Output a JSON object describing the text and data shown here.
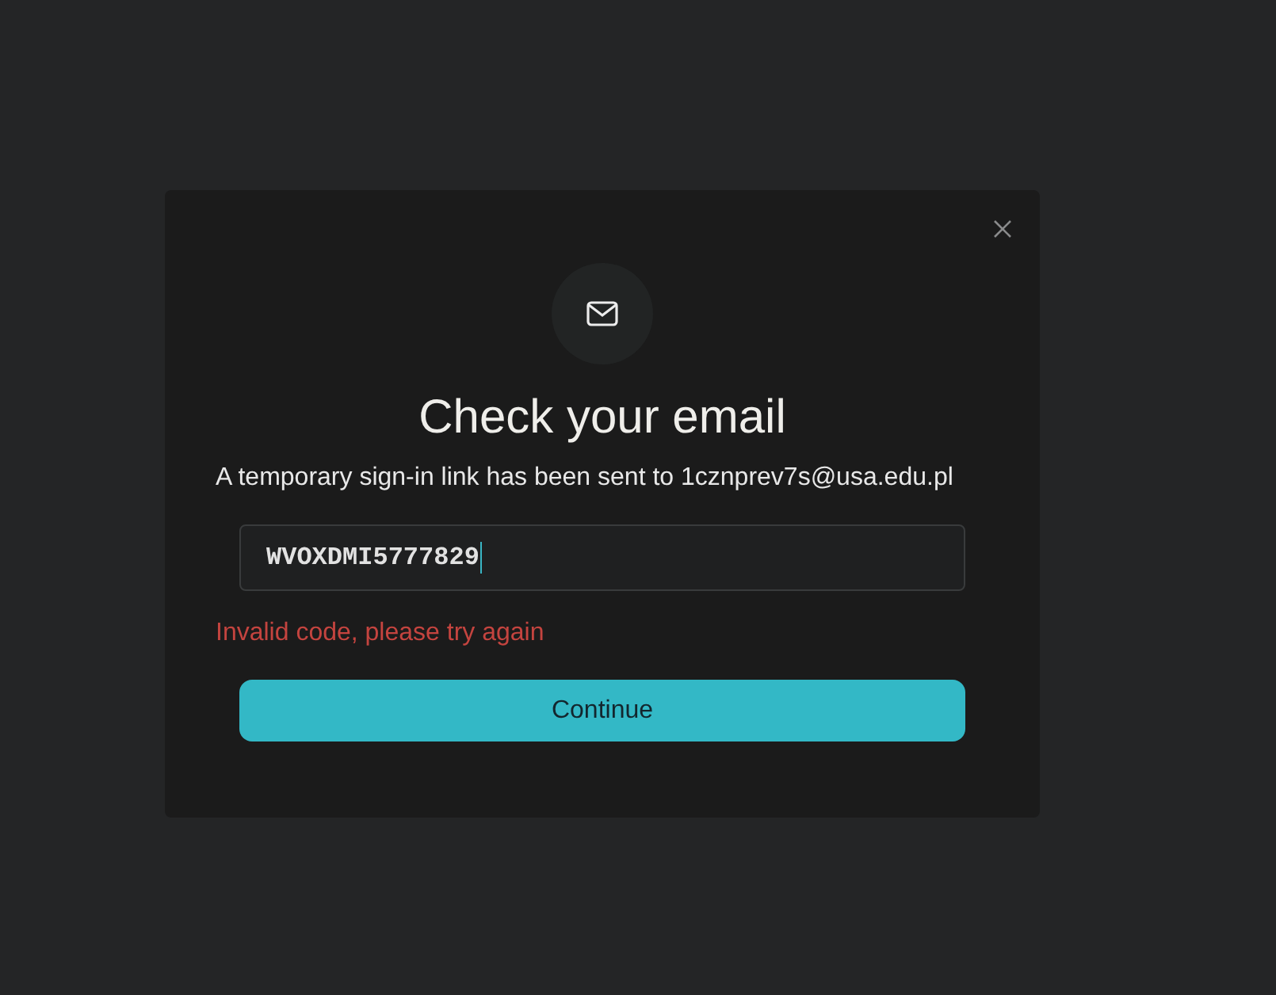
{
  "dialog": {
    "title": "Check your email",
    "message": "A temporary sign-in link has been sent to 1cznprev7s@usa.edu.pl",
    "code_input": {
      "value": "WVOXDMI5777829",
      "focused": true
    },
    "error": "Invalid code, please try again",
    "primary_button": {
      "label": "Continue"
    }
  }
}
